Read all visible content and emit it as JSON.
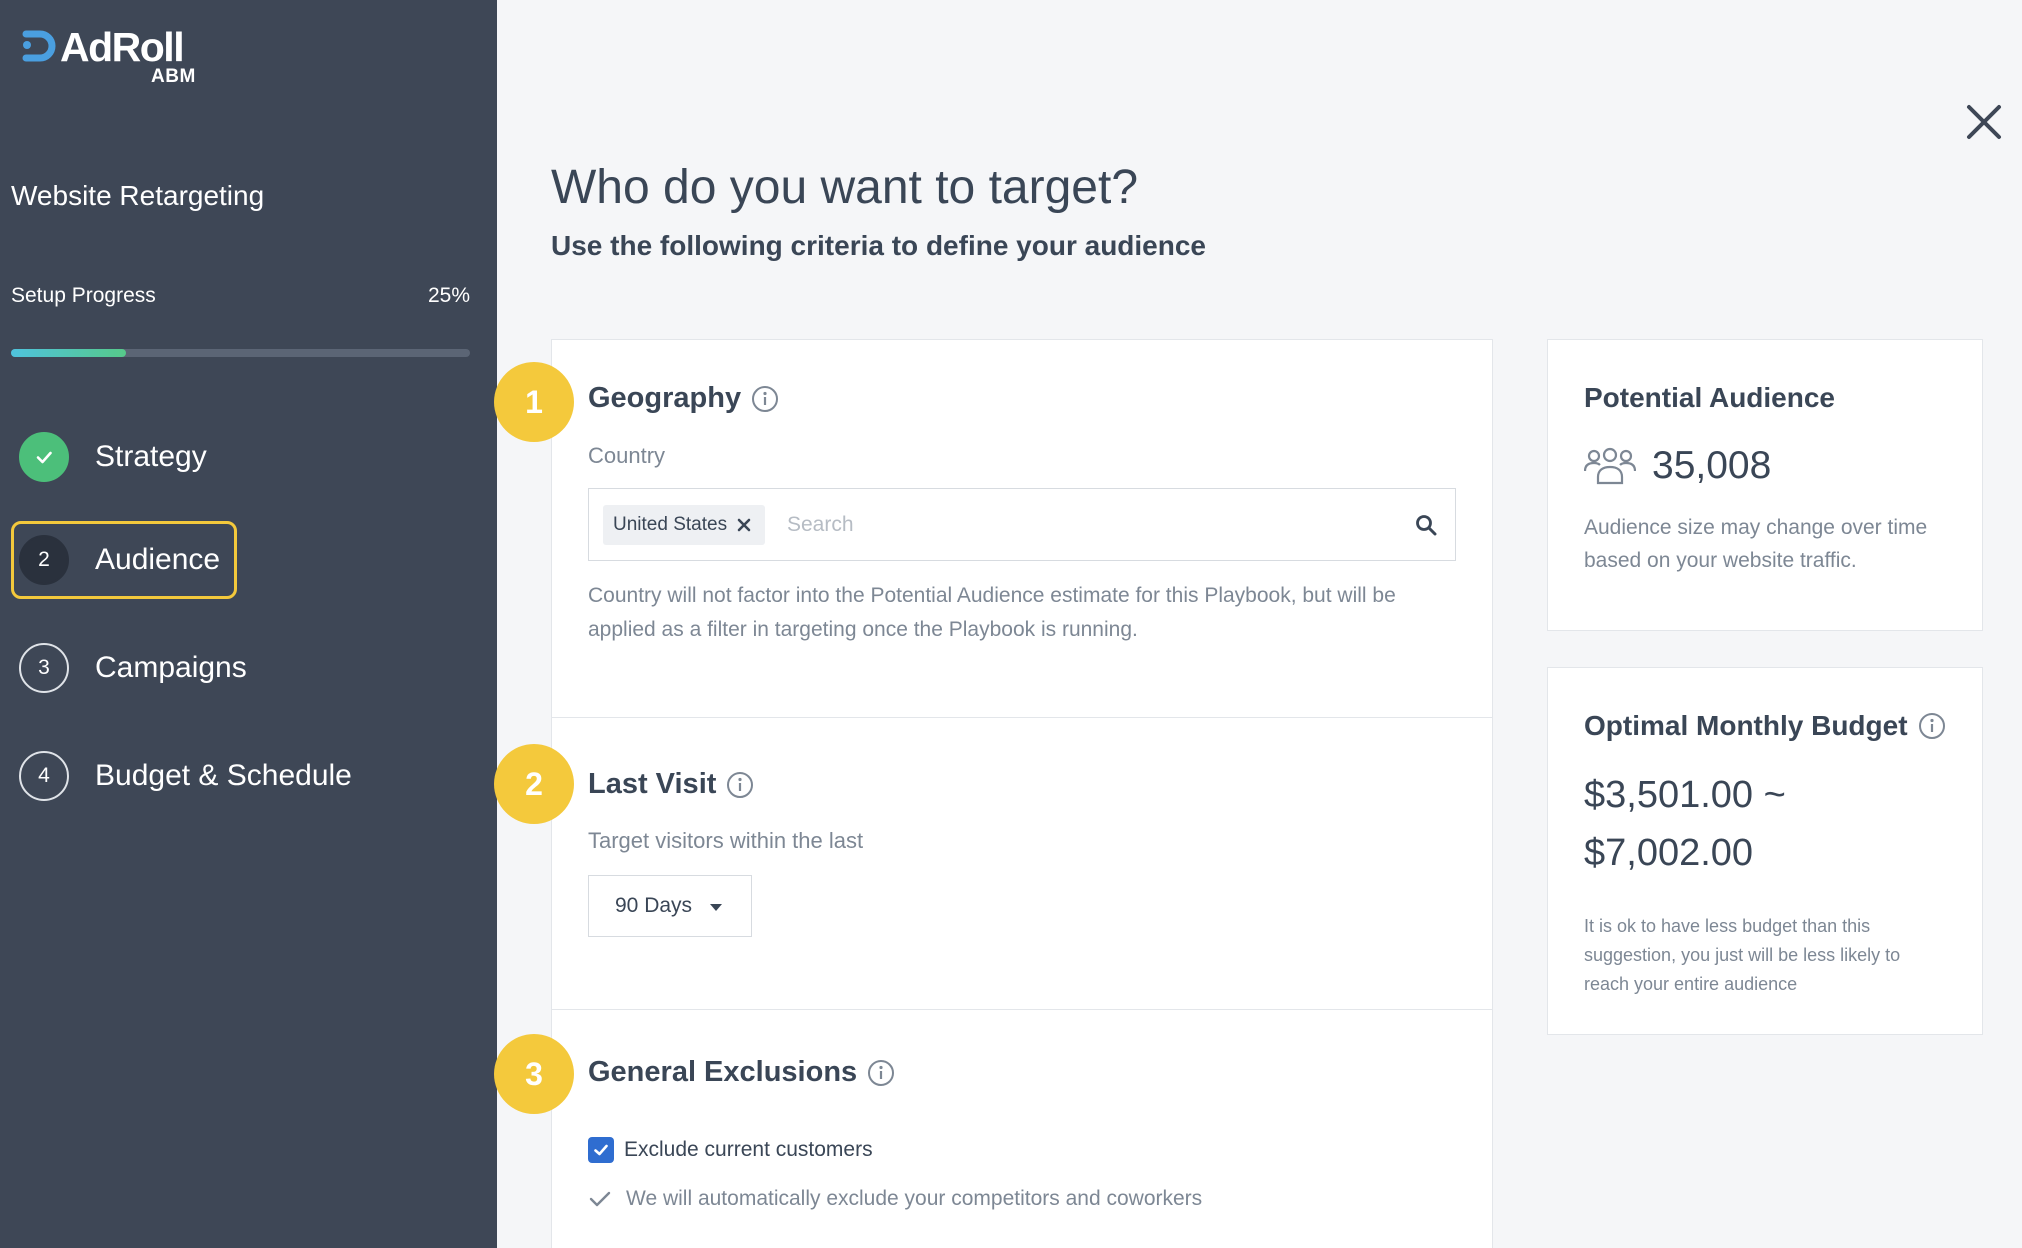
{
  "brand": {
    "name": "AdRoll",
    "product": "ABM",
    "accent_color": "#4a9fe0"
  },
  "sidebar": {
    "campaign_title": "Website Retargeting",
    "progress": {
      "label": "Setup Progress",
      "value_text": "25%",
      "fraction": 0.25
    },
    "steps": [
      {
        "number": "",
        "label": "Strategy",
        "state": "done",
        "icon": "check-icon"
      },
      {
        "number": "2",
        "label": "Audience",
        "state": "active"
      },
      {
        "number": "3",
        "label": "Campaigns",
        "state": "pending"
      },
      {
        "number": "4",
        "label": "Budget & Schedule",
        "state": "pending"
      }
    ]
  },
  "main": {
    "title": "Who do you want to target?",
    "subtitle": "Use the following criteria to define your audience",
    "sections": [
      {
        "badge": "1",
        "title": "Geography",
        "sublabel": "Country",
        "selected_country": "United States",
        "search_placeholder": "Search",
        "note": "Country will not factor into the Potential Audience estimate for this Playbook, but will be applied as a filter in targeting once the Playbook is running."
      },
      {
        "badge": "2",
        "title": "Last Visit",
        "sublabel": "Target visitors within the last",
        "dropdown_value": "90 Days"
      },
      {
        "badge": "3",
        "title": "General Exclusions",
        "checkbox_label": "Exclude current customers",
        "checkbox_checked": true,
        "auto_note": "We will automatically exclude your competitors and coworkers"
      }
    ]
  },
  "audience_card": {
    "title": "Potential Audience",
    "count": "35,008",
    "note": "Audience size may change over time based on your website traffic."
  },
  "budget_card": {
    "title": "Optimal Monthly Budget",
    "range_low": "$3,501.00 ~",
    "range_high": "$7,002.00",
    "note": "It is ok to have less budget than this suggestion, you just will be less likely to reach your entire audience"
  },
  "colors": {
    "sidebar_bg": "#3e4756",
    "badge_yellow": "#f4c93c",
    "success_green": "#4cbf7a",
    "checkbox_blue": "#2f6dd0"
  }
}
